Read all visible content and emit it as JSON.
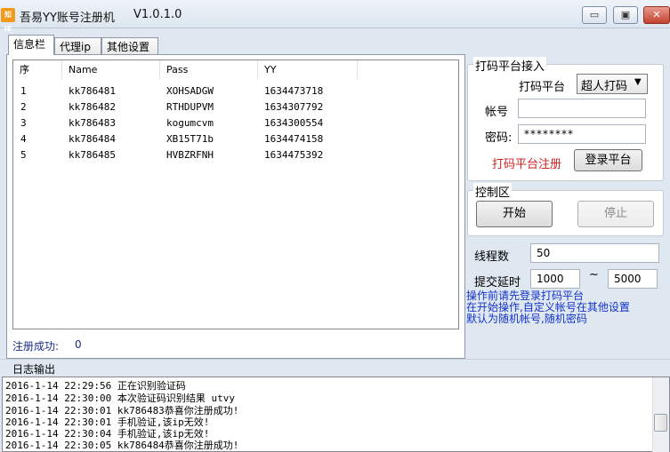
{
  "window": {
    "icon_text": "知IE",
    "title": "吾易YY账号注册机",
    "version": "V1.0.1.0",
    "minimize_glyph": "▭",
    "restore_glyph": "▣",
    "close_glyph": "✕"
  },
  "tabs": [
    {
      "label": "信息栏",
      "active": true
    },
    {
      "label": "代理ip",
      "active": false
    },
    {
      "label": "其他设置",
      "active": false
    }
  ],
  "table": {
    "headers": [
      "序",
      "Name",
      "Pass",
      "YY"
    ],
    "rows": [
      [
        "1",
        "kk786481",
        "XOHSADGW",
        "1634473718"
      ],
      [
        "2",
        "kk786482",
        "RTHDUPVM",
        "1634307792"
      ],
      [
        "3",
        "kk786483",
        "kogumcvm",
        "1634300554"
      ],
      [
        "4",
        "kk786484",
        "XB15T71b",
        "1634474158"
      ],
      [
        "5",
        "kk786485",
        "HVBZRFNH",
        "1634475392"
      ]
    ]
  },
  "status": {
    "success_label": "注册成功:",
    "success_count": "0"
  },
  "captcha_panel": {
    "title": "打码平台接入",
    "platform_label": "打码平台",
    "platform_value": "超人打码",
    "account_label": "帐号",
    "account_value": "",
    "password_label": "密码:",
    "password_value": "********",
    "register_link": "打码平台注册",
    "login_button": "登录平台"
  },
  "control_panel": {
    "title": "控制区",
    "start_button": "开始",
    "stop_button": "停止"
  },
  "settings": {
    "threads_label": "线程数",
    "threads_value": "50",
    "delay_label": "提交延时",
    "delay_min": "1000",
    "delay_sep": "~",
    "delay_max": "5000"
  },
  "notes": [
    "操作前请先登录打码平台",
    "在开始操作,自定义帐号在其他设置",
    "默认为随机帐号,随机密码"
  ],
  "log": {
    "title": "日志输出",
    "lines": [
      "2016-1-14 22:29:56 正在识别验证码",
      "2016-1-14 22:30:00 本次验证码识别结果 utvy",
      "2016-1-14 22:30:01 kk786483恭喜你注册成功!",
      "2016-1-14 22:30:01 手机验证,该ip无效!",
      "2016-1-14 22:30:04 手机验证,该ip无效!",
      "2016-1-14 22:30:05 kk786484恭喜你注册成功!"
    ]
  },
  "colors": {
    "accent_blue": "#1133cc",
    "link_red": "#cc2222",
    "status_blue": "#1b2f8c"
  }
}
